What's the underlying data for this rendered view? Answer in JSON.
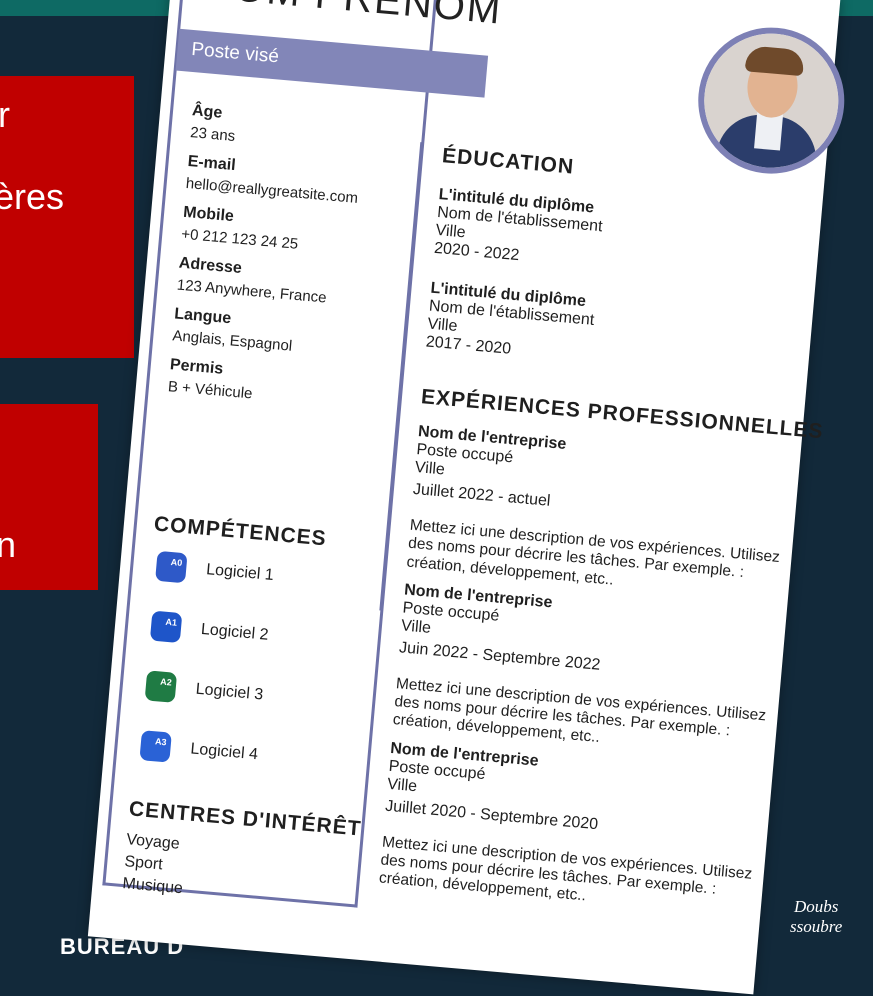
{
  "background": {
    "color": "#12293a",
    "strip_color": "#0e6a64",
    "red_box_1_text": [
      "r",
      "ères"
    ],
    "red_box_2_text": [
      "n"
    ],
    "bottom_text": "BUREAU D",
    "logo_line1": "Doubs",
    "logo_line2": "ssoubre"
  },
  "cv": {
    "name": "NOM PRÉNOM",
    "poste": "Poste visé",
    "age_label": "Âge",
    "age_value": "23 ans",
    "email_label": "E-mail",
    "email_value": "hello@reallygreatsite.com",
    "mobile_label": "Mobile",
    "mobile_value": "+0 212 123 24 25",
    "address_label": "Adresse",
    "address_value": "123 Anywhere, France",
    "language_label": "Langue",
    "language_value": "Anglais, Espagnol",
    "license_label": "Permis",
    "license_value": "B + Véhicule",
    "skills_title": "COMPÉTENCES",
    "skills": [
      {
        "icon": "A0",
        "label": "Logiciel 1",
        "color": "#2e59c8"
      },
      {
        "icon": "A1",
        "label": "Logiciel 2",
        "color": "#1e55c9"
      },
      {
        "icon": "A2",
        "label": "Logiciel 3",
        "color": "#1f7b44"
      },
      {
        "icon": "A3",
        "label": "Logiciel 4",
        "color": "#2a62d6"
      }
    ],
    "interests_title": "CENTRES D'INTÉRÊT",
    "interests": [
      "Voyage",
      "Sport",
      "Musique"
    ],
    "education_title": "ÉDUCATION",
    "education": [
      {
        "degree": "L'intitulé du diplôme",
        "school": "Nom de l'établissement",
        "city": "Ville",
        "years": "2020 - 2022"
      },
      {
        "degree": "L'intitulé du diplôme",
        "school": "Nom de l'établissement",
        "city": "Ville",
        "years": "2017 - 2020"
      }
    ],
    "experience_title": "EXPÉRIENCES PROFESSIONNELLES",
    "experience": [
      {
        "company": "Nom de l'entreprise",
        "position": "Poste occupé",
        "city": "Ville",
        "dates": "Juillet 2022 - actuel",
        "desc1": "Mettez ici une description de vos expériences. Utilisez",
        "desc2": "des noms pour décrire les tâches. Par exemple. :",
        "desc3": "création, développement, etc.."
      },
      {
        "company": "Nom de l'entreprise",
        "position": "Poste occupé",
        "city": "Ville",
        "dates": "Juin 2022 - Septembre 2022",
        "desc1": "Mettez ici une description de vos expériences. Utilisez",
        "desc2": "des noms pour décrire les tâches. Par exemple. :",
        "desc3": "création, développement, etc.."
      },
      {
        "company": "Nom de l'entreprise",
        "position": "Poste occupé",
        "city": "Ville",
        "dates": "Juillet 2020 - Septembre 2020",
        "desc1": "Mettez ici une description de vos expériences. Utilisez",
        "desc2": "des noms pour décrire les tâches. Par exemple. :",
        "desc3": "création, développement, etc.."
      }
    ]
  }
}
